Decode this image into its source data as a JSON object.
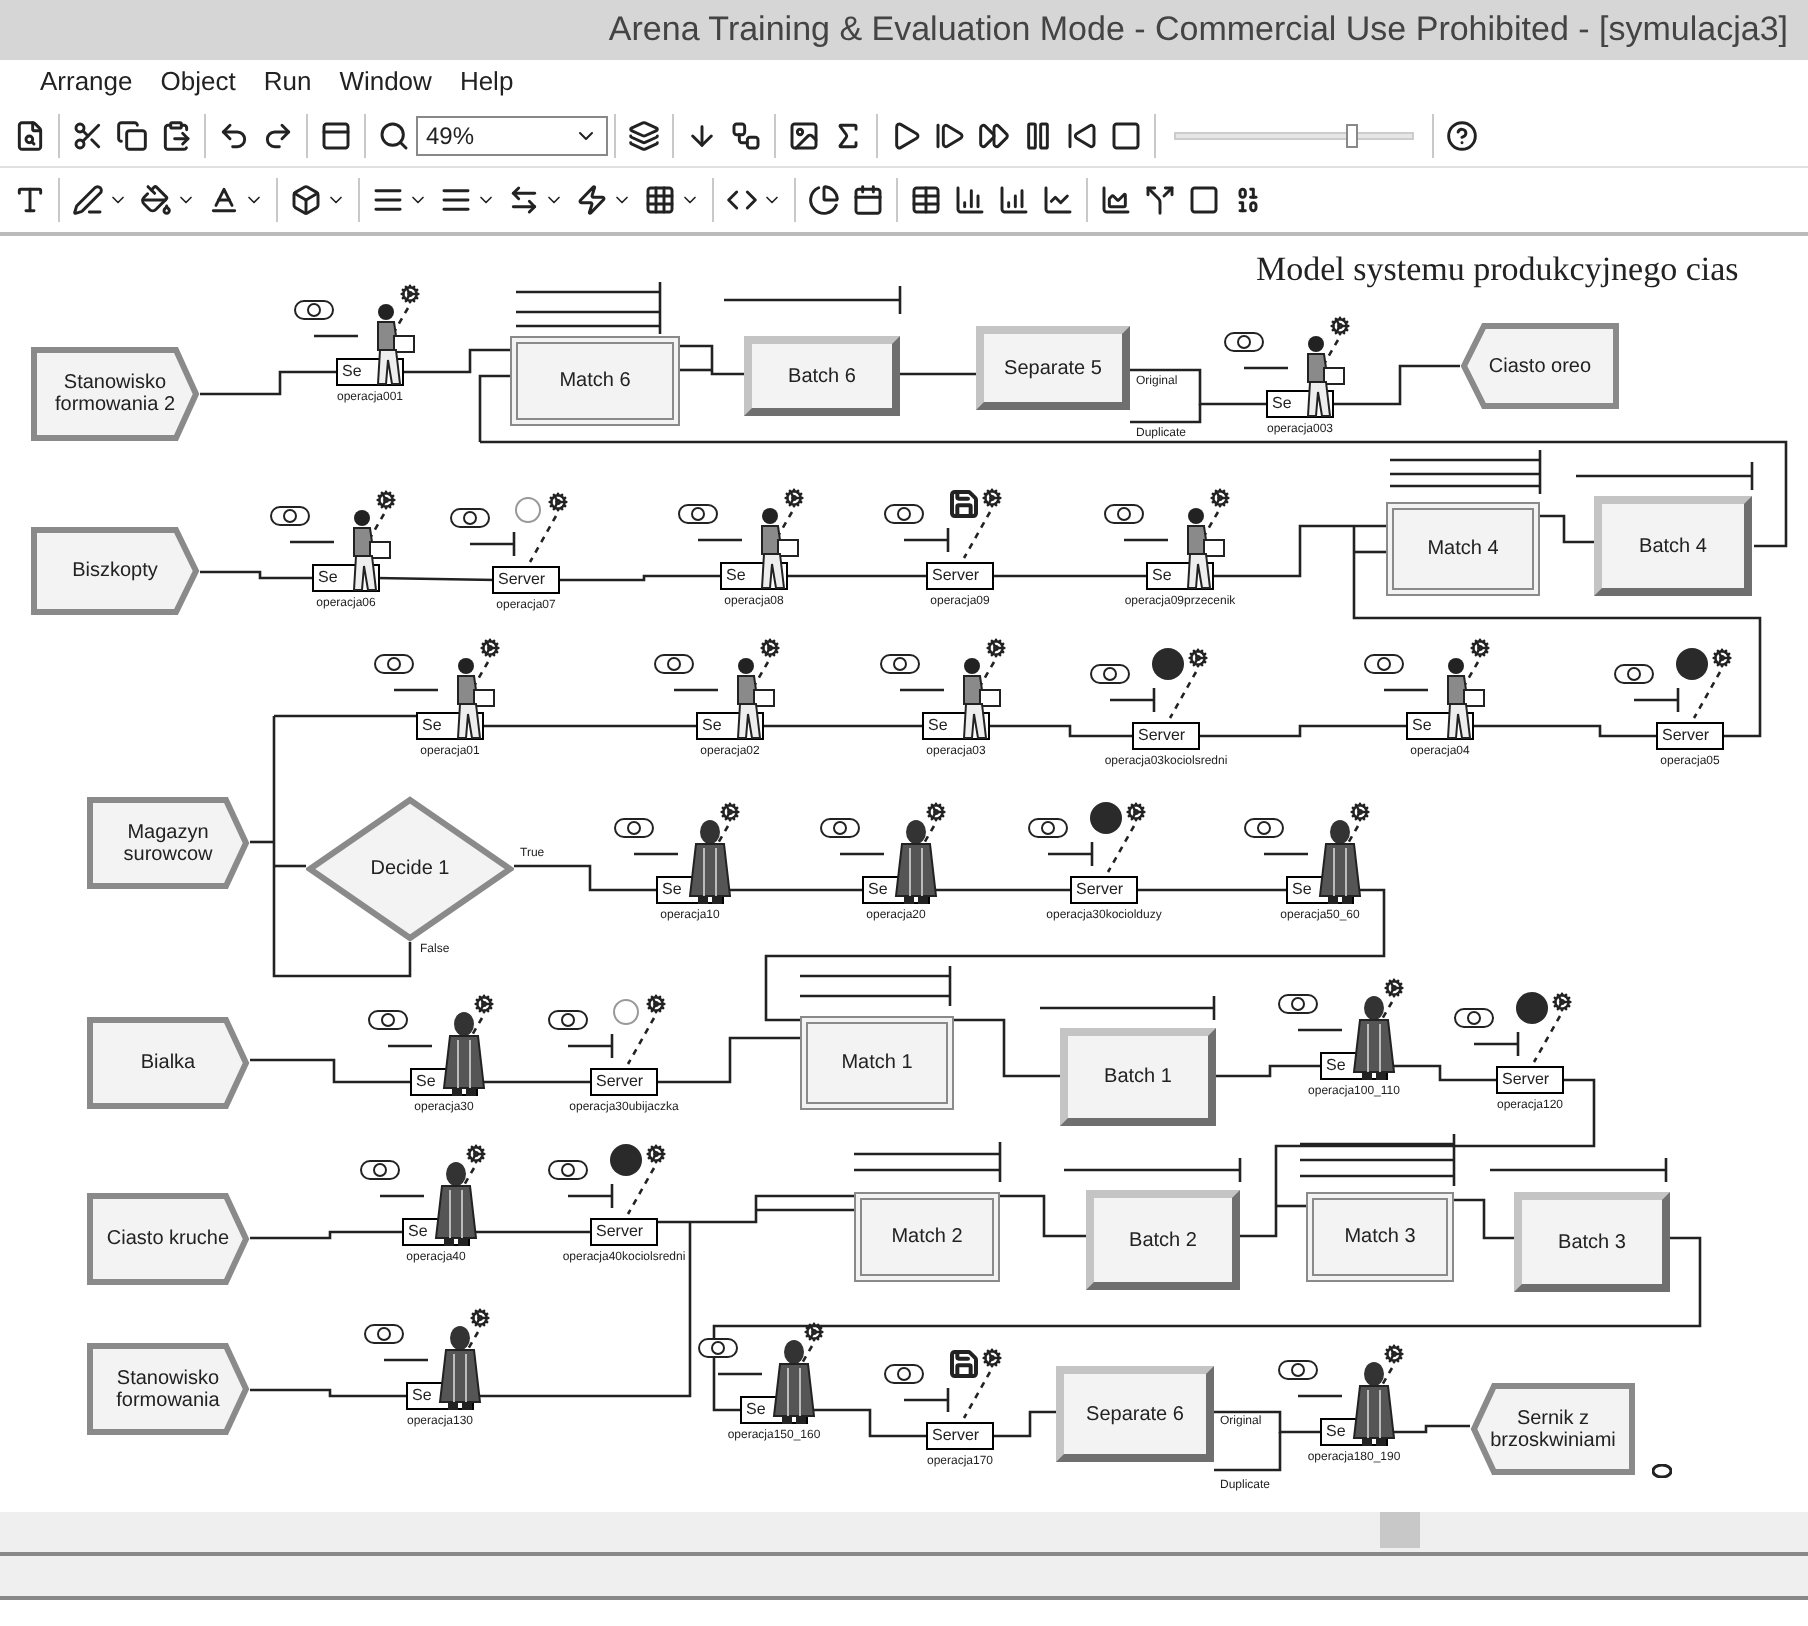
{
  "window": {
    "title": "Arena Training & Evaluation Mode - Commercial Use Prohibited - [symulacja3]"
  },
  "menu": [
    "Arrange",
    "Object",
    "Run",
    "Window",
    "Help"
  ],
  "toolbar": {
    "zoom": "49%",
    "run_speed": {
      "level": 0.74
    }
  },
  "canvas": {
    "title": "Model systemu produkcyjnego cias",
    "modules": [
      {
        "kind": "create",
        "label": "Stanowisko formowania 2"
      },
      {
        "kind": "process",
        "box_label": "Se",
        "caption": "operacja001",
        "resource": {
          "kind": "worker"
        }
      },
      {
        "kind": "match",
        "label": "Match 6"
      },
      {
        "kind": "batch",
        "label": "Batch 6"
      },
      {
        "kind": "separate",
        "label": "Separate 5",
        "outputs": [
          "Original",
          "Duplicate"
        ]
      },
      {
        "kind": "process",
        "box_label": "Se",
        "caption": "operacja003",
        "resource": {
          "kind": "worker"
        }
      },
      {
        "kind": "dispose",
        "label": "Ciasto oreo"
      },
      {
        "kind": "create",
        "label": "Biszkopty"
      },
      {
        "kind": "process",
        "box_label": "Se",
        "caption": "operacja06",
        "resource": {
          "kind": "worker"
        }
      },
      {
        "kind": "process",
        "box_label": "Server",
        "caption": "operacja07",
        "resource": {
          "kind": "idle"
        }
      },
      {
        "kind": "process",
        "box_label": "Se",
        "caption": "operacja08",
        "resource": {
          "kind": "worker"
        }
      },
      {
        "kind": "process",
        "box_label": "Server",
        "caption": "operacja09",
        "resource": {
          "kind": "disk"
        }
      },
      {
        "kind": "process",
        "box_label": "Se",
        "caption": "operacja09przecenik",
        "resource": {
          "kind": "worker"
        }
      },
      {
        "kind": "match",
        "label": "Match 4"
      },
      {
        "kind": "batch",
        "label": "Batch 4"
      },
      {
        "kind": "process",
        "box_label": "Se",
        "caption": "operacja01",
        "resource": {
          "kind": "worker"
        }
      },
      {
        "kind": "process",
        "box_label": "Se",
        "caption": "operacja02",
        "resource": {
          "kind": "worker"
        }
      },
      {
        "kind": "process",
        "box_label": "Se",
        "caption": "operacja03",
        "resource": {
          "kind": "worker"
        }
      },
      {
        "kind": "process",
        "box_label": "Server",
        "caption": "operacja03kociolsredni",
        "resource": {
          "kind": "busy"
        }
      },
      {
        "kind": "process",
        "box_label": "Se",
        "caption": "operacja04",
        "resource": {
          "kind": "worker"
        }
      },
      {
        "kind": "process",
        "box_label": "Server",
        "caption": "operacja05",
        "resource": {
          "kind": "busy"
        }
      },
      {
        "kind": "create",
        "label": "Magazyn surowcow"
      },
      {
        "kind": "decide",
        "label": "Decide 1",
        "outputs": [
          "True",
          "False"
        ]
      },
      {
        "kind": "process",
        "box_label": "Se",
        "caption": "operacja10",
        "resource": {
          "kind": "operator"
        }
      },
      {
        "kind": "process",
        "box_label": "Se",
        "caption": "operacja20",
        "resource": {
          "kind": "operator"
        }
      },
      {
        "kind": "process",
        "box_label": "Server",
        "caption": "operacja30kociolduzy",
        "resource": {
          "kind": "busy"
        }
      },
      {
        "kind": "process",
        "box_label": "Se",
        "caption": "operacja50_60",
        "resource": {
          "kind": "operator"
        }
      },
      {
        "kind": "create",
        "label": "Bialka"
      },
      {
        "kind": "process",
        "box_label": "Se",
        "caption": "operacja30",
        "resource": {
          "kind": "operator"
        }
      },
      {
        "kind": "process",
        "box_label": "Server",
        "caption": "operacja30ubijaczka",
        "resource": {
          "kind": "idle"
        }
      },
      {
        "kind": "match",
        "label": "Match 1"
      },
      {
        "kind": "batch",
        "label": "Batch 1"
      },
      {
        "kind": "process",
        "box_label": "Se",
        "caption": "operacja100_110",
        "resource": {
          "kind": "operator"
        }
      },
      {
        "kind": "process",
        "box_label": "Server",
        "caption": "operacja120",
        "resource": {
          "kind": "busy"
        }
      },
      {
        "kind": "create",
        "label": "Ciasto kruche"
      },
      {
        "kind": "process",
        "box_label": "Se",
        "caption": "operacja40",
        "resource": {
          "kind": "operator"
        }
      },
      {
        "kind": "process",
        "box_label": "Server",
        "caption": "operacja40kociolsredni",
        "resource": {
          "kind": "busy"
        }
      },
      {
        "kind": "match",
        "label": "Match 2"
      },
      {
        "kind": "batch",
        "label": "Batch 2"
      },
      {
        "kind": "match",
        "label": "Match 3"
      },
      {
        "kind": "batch",
        "label": "Batch 3"
      },
      {
        "kind": "create",
        "label": "Stanowisko formowania"
      },
      {
        "kind": "process",
        "box_label": "Se",
        "caption": "operacja130",
        "resource": {
          "kind": "operator"
        }
      },
      {
        "kind": "process",
        "box_label": "Se",
        "caption": "operacja150_160",
        "resource": {
          "kind": "operator"
        }
      },
      {
        "kind": "process",
        "box_label": "Server",
        "caption": "operacja170",
        "resource": {
          "kind": "disk"
        }
      },
      {
        "kind": "separate",
        "label": "Separate 6",
        "outputs": [
          "Original",
          "Duplicate"
        ]
      },
      {
        "kind": "process",
        "box_label": "Se",
        "caption": "operacja180_190",
        "resource": {
          "kind": "operator"
        }
      },
      {
        "kind": "dispose",
        "label": "Sernik z brzoskwiniami"
      }
    ]
  }
}
